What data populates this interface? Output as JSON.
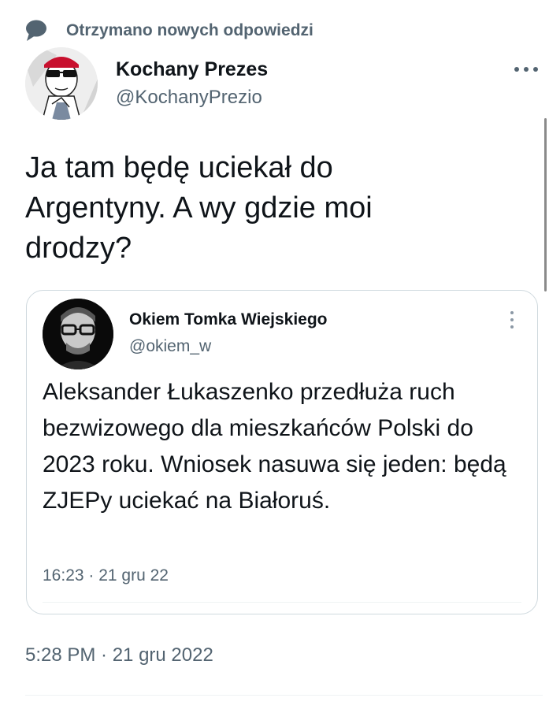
{
  "notice": {
    "icon": "speech-bubble-icon",
    "text": "Otrzymano nowych odpowiedzi"
  },
  "tweet": {
    "author": {
      "display_name": "Kochany Prezes",
      "handle": "@KochanyPrezio",
      "avatar": "cartoon-avatar-with-sunglasses"
    },
    "more_icon": "more-horizontal-icon",
    "text": "Ja tam będę uciekał do Argentyny. A wy gdzie moi drodzy?",
    "timestamp": "5:28 PM · 21 gru 2022"
  },
  "quoted_tweet": {
    "author": {
      "display_name": "Okiem Tomka Wiejskiego",
      "handle": "@okiem_w",
      "avatar": "man-with-glasses-avatar"
    },
    "more_icon": "more-vertical-icon",
    "text": "Aleksander Łukaszenko przedłuża ruch bezwizowego dla mieszkańców Polski do 2023 roku. Wniosek nasuwa się jeden: będą ZJEPy uciekać na Białoruś.",
    "time": "16:23 · 21 gru 22"
  },
  "colors": {
    "primary_text": "#0f1419",
    "secondary_text": "#536471",
    "border": "#cfd9de"
  }
}
